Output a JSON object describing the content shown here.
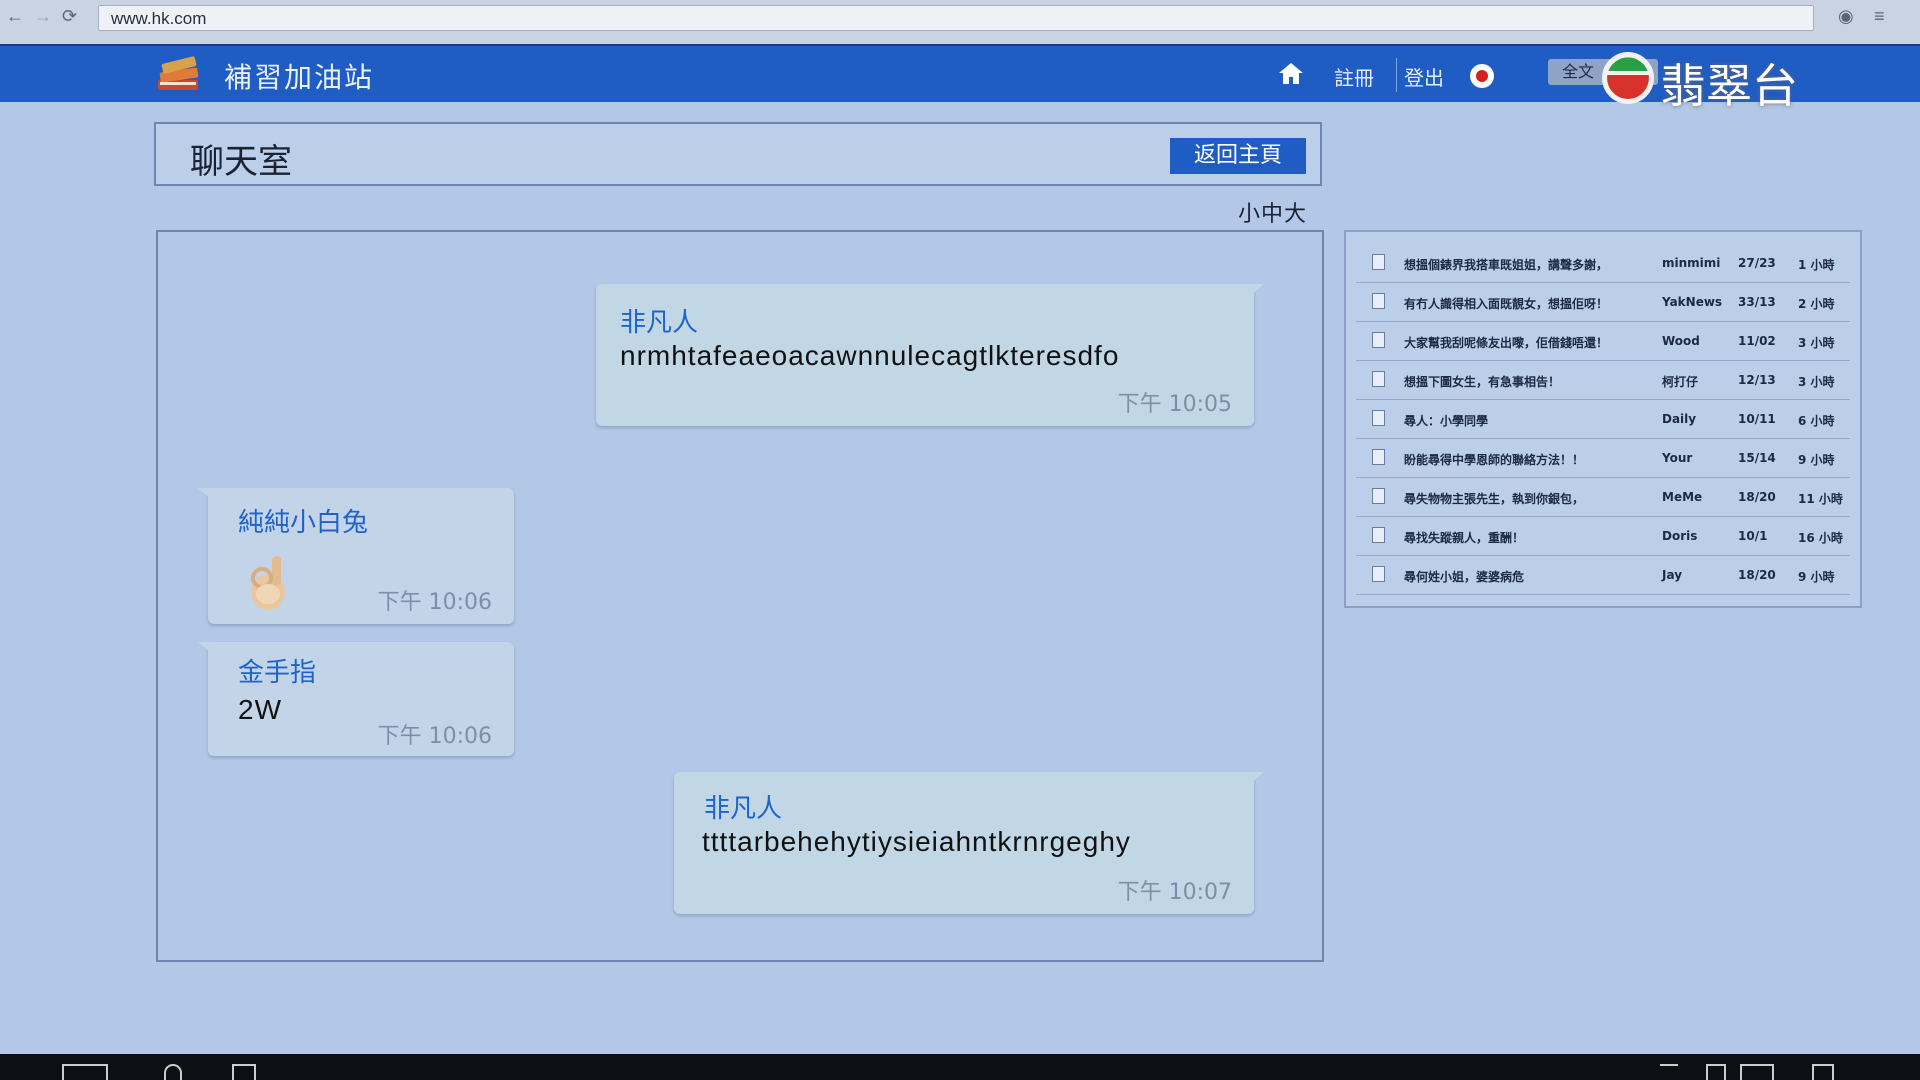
{
  "browser": {
    "url": "www.hk.com",
    "back": "←",
    "forward": "→",
    "reload": "⟳",
    "eye": "◉",
    "menu": "≡"
  },
  "header": {
    "site_title": "補習加油站",
    "register": "註冊",
    "logout": "登出",
    "search_label": "全文"
  },
  "watermark": {
    "text": "翡翠台"
  },
  "room": {
    "title": "聊天室",
    "back_button": "返回主頁",
    "font_size_control": "小中大"
  },
  "messages": [
    {
      "sender": "非凡人",
      "text": "nrmhtafeaeoacawnnulecagtlkteresdfo",
      "time": "下午 10:05",
      "side": "right"
    },
    {
      "sender": "純純小白兔",
      "text": "",
      "emoji": "ok-hand",
      "time": "下午 10:06",
      "side": "left"
    },
    {
      "sender": "金手指",
      "text": "2W",
      "time": "下午 10:06",
      "side": "left"
    },
    {
      "sender": "非凡人",
      "text": "ttttarbehehytiysieiahntkrnrgeghy",
      "time": "下午 10:07",
      "side": "right"
    }
  ],
  "topics": [
    {
      "title": "想搵個錶界我搭車既姐姐，講聲多謝，",
      "author": "minmimi",
      "date": "27/23",
      "ago": "1 小時"
    },
    {
      "title": "有冇人識得相入面既靚女，想搵佢呀！",
      "author": "YakNews",
      "date": "33/13",
      "ago": "2 小時"
    },
    {
      "title": "大家幫我刮呢條友出嚟，佢借錢唔還！",
      "author": "Wood",
      "date": "11/02",
      "ago": "3 小時"
    },
    {
      "title": "想搵下圖女生，有急事相告！",
      "author": "柯打仔",
      "date": "12/13",
      "ago": "3 小時"
    },
    {
      "title": "尋人：小學同學",
      "author": "Daily",
      "date": "10/11",
      "ago": "6 小時"
    },
    {
      "title": "盼能尋得中學恩師的聯絡方法！！",
      "author": "Your",
      "date": "15/14",
      "ago": "9 小時"
    },
    {
      "title": "尋失物物主張先生，執到你銀包，",
      "author": "MeMe",
      "date": "18/20",
      "ago": "11 小時"
    },
    {
      "title": "尋找失蹤親人，重酬！",
      "author": "Doris",
      "date": "10/1",
      "ago": "16 小時"
    },
    {
      "title": "尋何姓小姐，婆婆病危",
      "author": "Jay",
      "date": "18/20",
      "ago": "9 小時"
    }
  ],
  "colors": {
    "header_blue": "#1f5cc4",
    "page_bg": "#b3c8e6",
    "sender_blue": "#1f63c9"
  }
}
